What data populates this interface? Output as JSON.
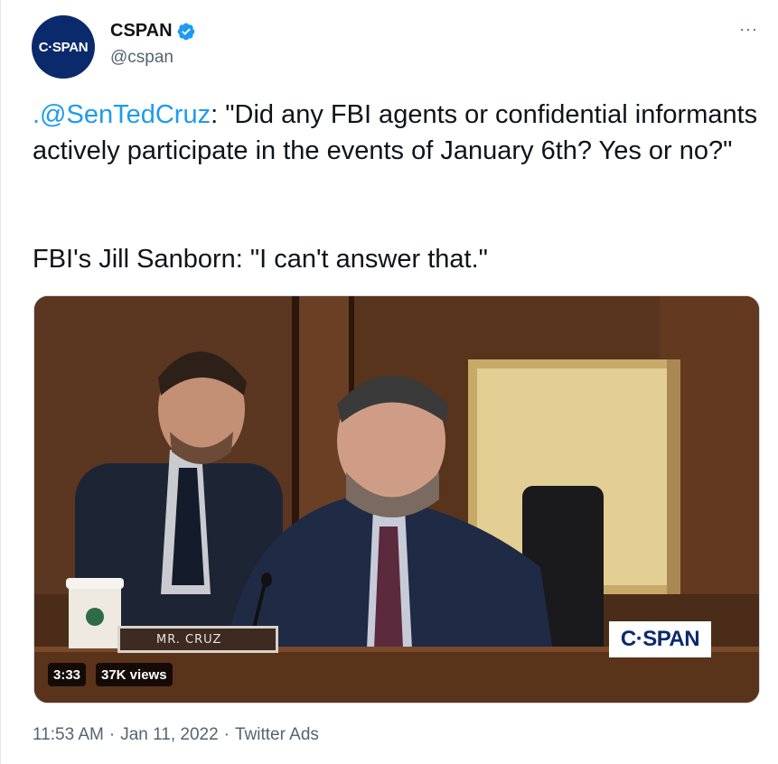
{
  "header": {
    "avatar_text": "C·SPAN",
    "display_name": "CSPAN",
    "handle": "@cspan",
    "more_label": "···",
    "verified_icon": "verified-badge-icon"
  },
  "tweet": {
    "mention": ".@SenTedCruz",
    "text_line1_rest": ": \"Did any FBI agents or confidential informants actively participate in the events of January 6th? Yes or no?\"",
    "paragraph2": "FBI's Jill Sanborn: \"I can't answer that.\""
  },
  "video": {
    "nameplate": "MR. CRUZ",
    "watermark": "C·SPAN",
    "duration": "3:33",
    "views": "37K views"
  },
  "meta": {
    "time": "11:53 AM",
    "sep1": "·",
    "date": "Jan 11, 2022",
    "sep2": "·",
    "source": "Twitter Ads"
  },
  "colors": {
    "link": "#1d9bf0",
    "verified": "#1d9bf0",
    "avatar_bg": "#0b2a6b",
    "secondary_text": "#536471"
  }
}
